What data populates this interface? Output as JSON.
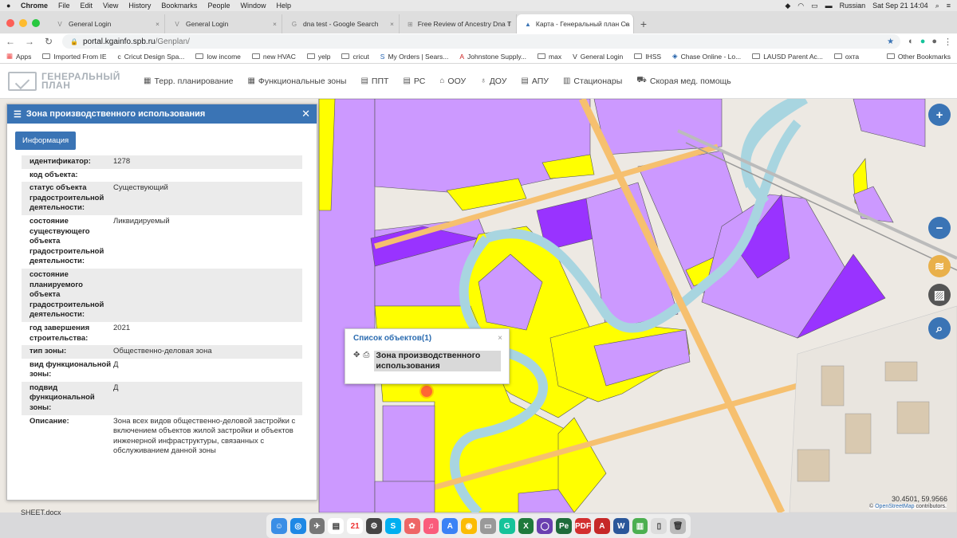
{
  "mac": {
    "menu": [
      "Chrome",
      "File",
      "Edit",
      "View",
      "History",
      "Bookmarks",
      "People",
      "Window",
      "Help"
    ],
    "input_lang": "Russian",
    "datetime": "Sat Sep 21  14:04"
  },
  "tabs": [
    {
      "label": "General Login",
      "icon": "V"
    },
    {
      "label": "General Login",
      "icon": "V"
    },
    {
      "label": "dna test - Google Search",
      "icon": "G"
    },
    {
      "label": "Free Review of Ancestry Dna T",
      "icon": "⊞"
    },
    {
      "label": "Карта - Генеральный план Са",
      "icon": "▲",
      "active": true
    }
  ],
  "address": {
    "host": "portal.kgainfo.spb.ru",
    "path": "/Genplan/"
  },
  "bookmarks": [
    "Apps",
    "Imported From IE",
    "Cricut Design Spa...",
    "low income",
    "new HVAC",
    "yelp",
    "cricut",
    "My Orders | Sears...",
    "Johnstone Supply...",
    "max",
    "General Login",
    "IHSS",
    "Chase Online - Lo...",
    "LAUSD Parent Ac...",
    "охта"
  ],
  "other_bookmarks": "Other Bookmarks",
  "app": {
    "logo_line1": "ГЕНЕРАЛЬНЫЙ",
    "logo_line2": "ПЛАН",
    "nav": [
      {
        "label": "Терр. планирование",
        "icon": "grid-icon"
      },
      {
        "label": "Функциональные зоны",
        "icon": "grid-icon"
      },
      {
        "label": "ППТ",
        "icon": "table-icon"
      },
      {
        "label": "РС",
        "icon": "table-icon"
      },
      {
        "label": "ООУ",
        "icon": "building-icon"
      },
      {
        "label": "ДОУ",
        "icon": "balloon-icon"
      },
      {
        "label": "АПУ",
        "icon": "table-icon"
      },
      {
        "label": "Стационары",
        "icon": "hospital-icon"
      },
      {
        "label": "Скорая мед. помощь",
        "icon": "ambulance-icon"
      }
    ]
  },
  "panel": {
    "title": "Зона производственного использования",
    "tab": "Информация",
    "rows": [
      {
        "k": "идентификатор:",
        "v": "1278"
      },
      {
        "k": "код объекта:",
        "v": ""
      },
      {
        "k": "статус объекта градостроительной деятельности:",
        "v": "Существующий"
      },
      {
        "k": "состояние существующего объекта градостроительной деятельности:",
        "v": "Ликвидируемый"
      },
      {
        "k": "состояние планируемого объекта градостроительной деятельности:",
        "v": ""
      },
      {
        "k": "год завершения строительства:",
        "v": "2021"
      },
      {
        "k": "тип зоны:",
        "v": "Общественно-деловая зона"
      },
      {
        "k": "вид функциональной зоны:",
        "v": "Д"
      },
      {
        "k": "подвид функциональной зоны:",
        "v": "Д"
      },
      {
        "k": "Описание:",
        "v": "Зона всех видов общественно-деловой застройки с включением объектов жилой застройки и объектов инженерной инфраструктуры, связанных с обслуживанием данной зоны"
      }
    ]
  },
  "popup": {
    "title": "Список объектов(1)",
    "zone": "Зона производственного использования"
  },
  "map": {
    "coords": "30.4501, 59.9566",
    "attribution_prefix": "© ",
    "attribution_link": "OpenStreetMap",
    "attribution_suffix": " contributors.",
    "colors": {
      "purple": "#cc99ff",
      "dark_purple": "#9933ff",
      "yellow": "#ffff00",
      "river": "#a8d5e0",
      "road": "#f6c06f"
    }
  },
  "desktop": {
    "file_label": "SHEET.docx"
  },
  "colors": {
    "accent": "#3a74b5"
  }
}
